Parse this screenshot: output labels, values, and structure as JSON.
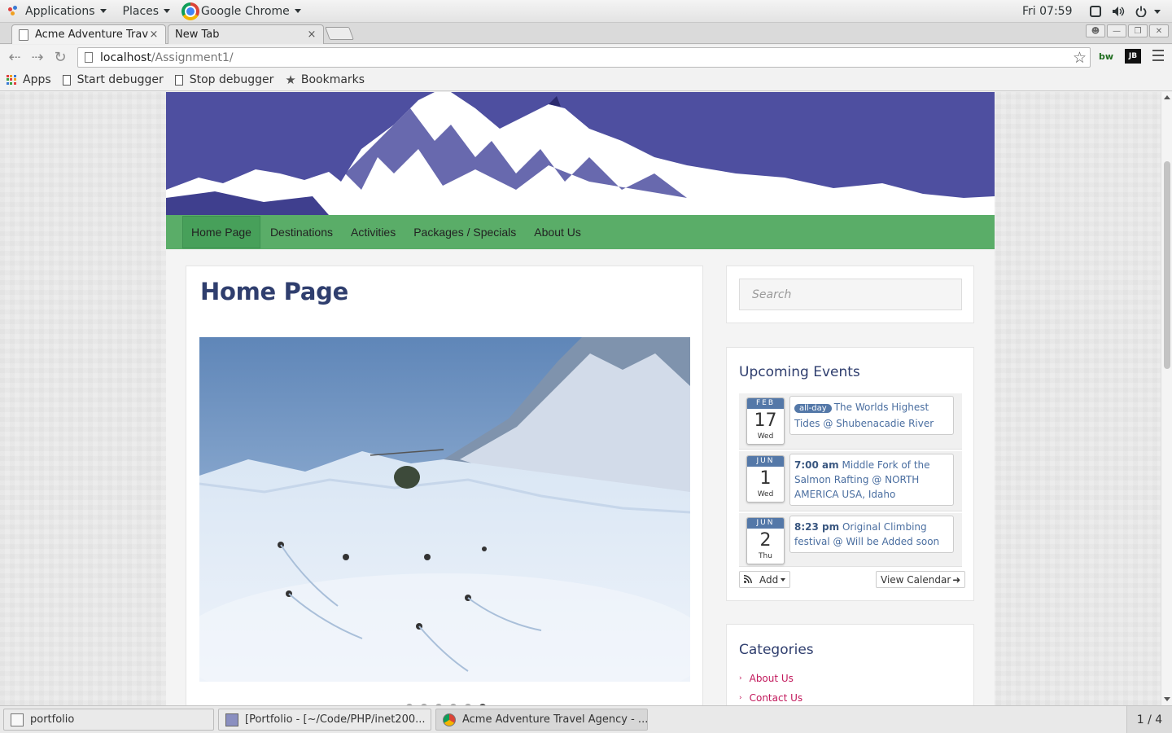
{
  "topbar": {
    "applications": "Applications",
    "places": "Places",
    "active_app": "Google Chrome",
    "clock": "Fri 07:59"
  },
  "tabs": [
    {
      "title": "Acme Adventure Trav",
      "close": "×"
    },
    {
      "title": "New Tab",
      "close": "×"
    }
  ],
  "toolbar": {
    "url_host": "localhost",
    "url_path": "/Assignment1/",
    "ext1": "bw",
    "ext2": "JB"
  },
  "bookmarks": {
    "apps": "Apps",
    "items": [
      "Start debugger",
      "Stop debugger",
      "Bookmarks"
    ]
  },
  "site": {
    "nav": [
      "Home Page",
      "Destinations",
      "Activities",
      "Packages / Specials",
      "About Us"
    ],
    "active_nav": "Home Page",
    "page_title": "Home Page",
    "slideshow_dots": 6
  },
  "sidebar": {
    "search_placeholder": "Search",
    "events_title": "Upcoming Events",
    "events": [
      {
        "month": "FEB",
        "day": "17",
        "weekday": "Wed",
        "badge": "all-day",
        "time": "",
        "text": "The Worlds Highest Tides @ Shubenacadie River"
      },
      {
        "month": "JUN",
        "day": "1",
        "weekday": "Wed",
        "badge": "",
        "time": "7:00 am",
        "text": "Middle Fork of the Salmon Rafting @ NORTH AMERICA USA, Idaho"
      },
      {
        "month": "JUN",
        "day": "2",
        "weekday": "Thu",
        "badge": "",
        "time": "8:23 pm",
        "text": "Original Climbing festival @ Will be Added soon"
      }
    ],
    "add_label": "Add",
    "view_calendar_label": "View Calendar",
    "categories_title": "Categories",
    "categories": [
      "About Us",
      "Contact Us"
    ]
  },
  "taskbar": {
    "tasks": [
      {
        "label": "portfolio"
      },
      {
        "label": "[Portfolio - [~/Code/PHP/inet200..."
      },
      {
        "label": "Acme Adventure Travel Agency - ..."
      }
    ],
    "workspace": "1 / 4"
  },
  "colors": {
    "nav_green": "#5aad68",
    "banner_blue": "#4e4fa0",
    "title_navy": "#2f3e6e",
    "category_link": "#c2185b",
    "date_badge": "#5478a8"
  }
}
